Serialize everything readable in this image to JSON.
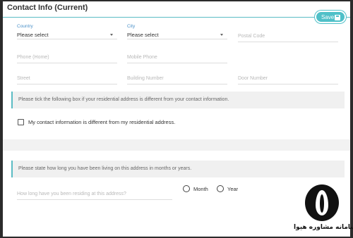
{
  "header": {
    "title": "Contact Info (Current)",
    "save_label": "Save"
  },
  "fields": {
    "country": {
      "label": "Country",
      "value": "Please select"
    },
    "city": {
      "label": "City",
      "value": "Please select"
    },
    "postal_code": {
      "placeholder": "Postal Code"
    },
    "phone_home": {
      "placeholder": "Phone (Home)"
    },
    "mobile_phone": {
      "placeholder": "Mobile Phone"
    },
    "street": {
      "placeholder": "Street"
    },
    "building_number": {
      "placeholder": "Building Number"
    },
    "door_number": {
      "placeholder": "Door Number"
    }
  },
  "info1": "Please tick the following box if your residential address is different from your contact information.",
  "checkbox_label": "My contact information is different from my residential address.",
  "info2": "Please state how long you have been living on this address in months or years.",
  "duration": {
    "placeholder": "How long have you been residing at this address?"
  },
  "radios": {
    "month": "Month",
    "year": "Year"
  },
  "brand": "سامانه مشاوره هیوا",
  "colors": {
    "accent": "#5bbcc4",
    "label_blue": "#4a90c8"
  }
}
